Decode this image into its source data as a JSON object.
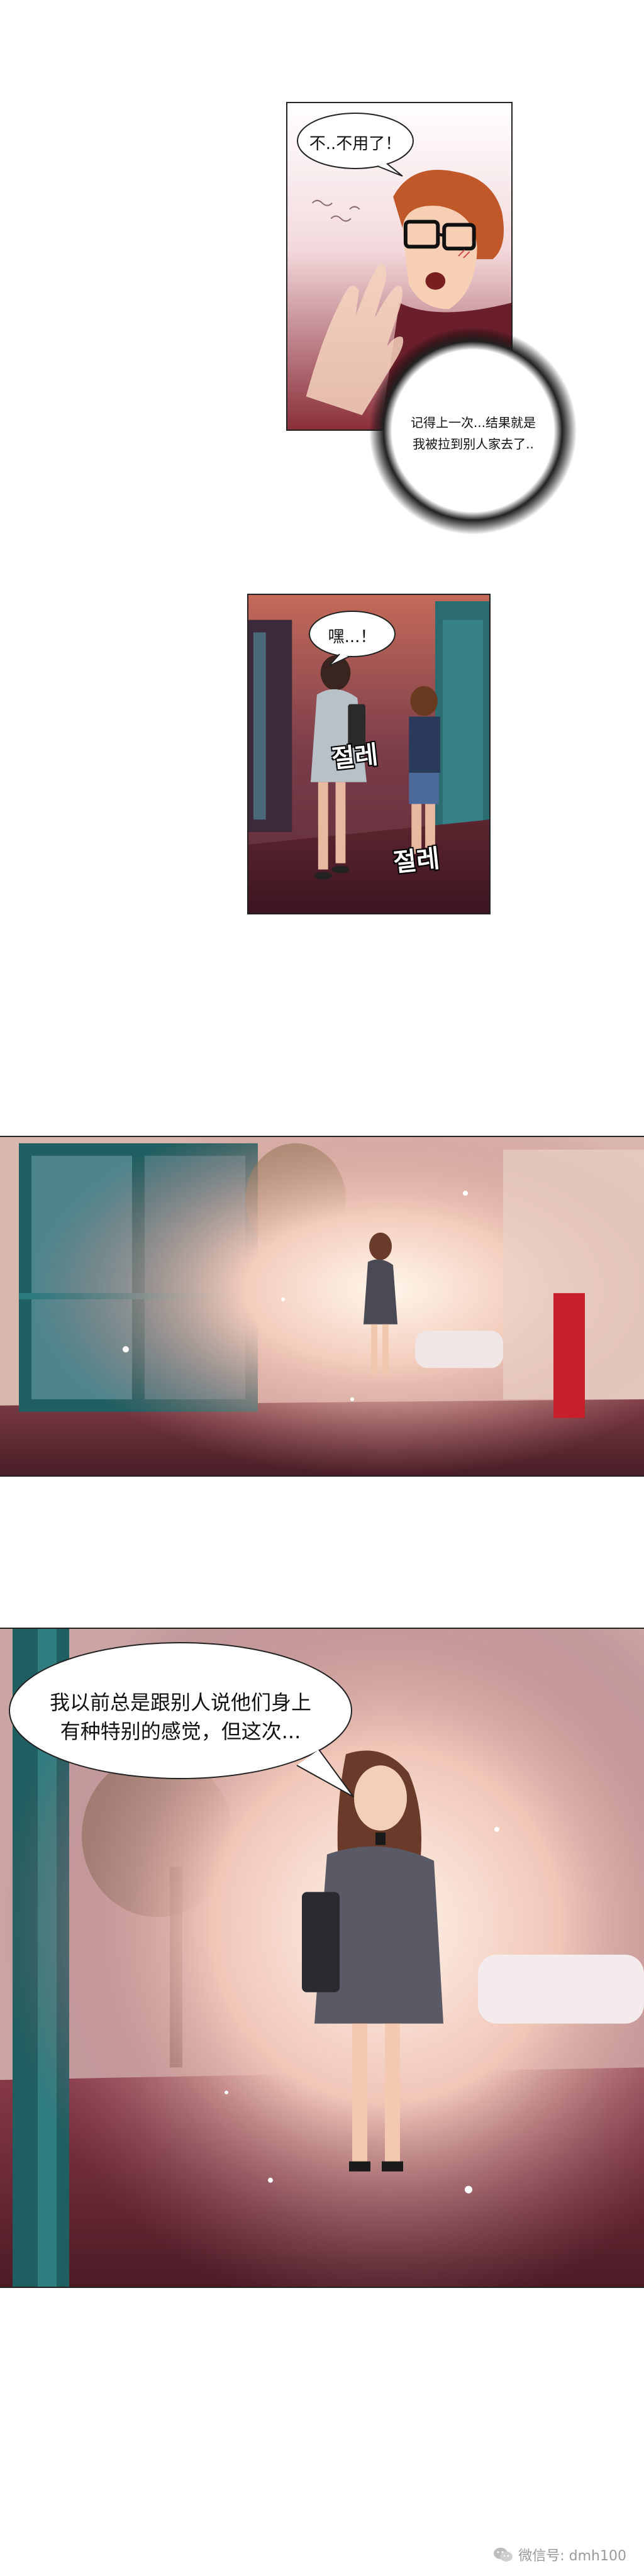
{
  "panel1": {
    "bubble_top": "不..不用了！",
    "thought_line1": "记得上一次...结果就是",
    "thought_line2": "我被拉到别人家去了.."
  },
  "panel2": {
    "bubble": "嘿...！",
    "sfx1": "절레",
    "sfx2": "절레"
  },
  "panel4": {
    "bubble_line1": "我以前总是跟别人说他们身上",
    "bubble_line2": "有种特别的感觉，但这次..."
  },
  "watermark": {
    "icon": "wechat-icon",
    "text": "微信号: dmh100"
  }
}
